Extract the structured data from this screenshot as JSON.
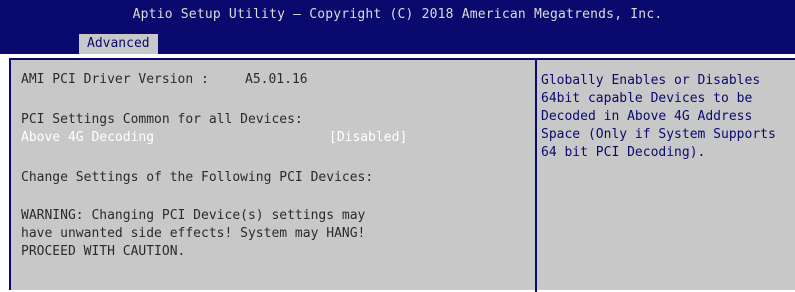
{
  "header": {
    "title": "Aptio Setup Utility – Copyright (C) 2018 American Megatrends, Inc.",
    "tab_label": "Advanced"
  },
  "main": {
    "driver_version_label": "AMI PCI Driver Version :",
    "driver_version_value": "A5.01.16",
    "pci_settings_common": "PCI Settings Common for all Devices:",
    "setting_above_4g_label": "Above 4G Decoding",
    "setting_above_4g_value": "[Disabled]",
    "change_settings": "Change Settings of the Following PCI Devices:",
    "warning_line1": "WARNING: Changing PCI Device(s) settings may",
    "warning_line2": "have unwanted side effects! System may HANG!",
    "warning_line3": "PROCEED WITH CAUTION."
  },
  "help": {
    "text": "Globally Enables or Disables\n64bit capable Devices to be\nDecoded in Above 4G Address\nSpace (Only if System Supports\n64 bit PCI Decoding)."
  },
  "colors": {
    "header_bg": "#0a0a6e",
    "panel_bg": "#c8c8c8",
    "selected_text": "#ffffff",
    "help_text": "#0a0a6e"
  }
}
